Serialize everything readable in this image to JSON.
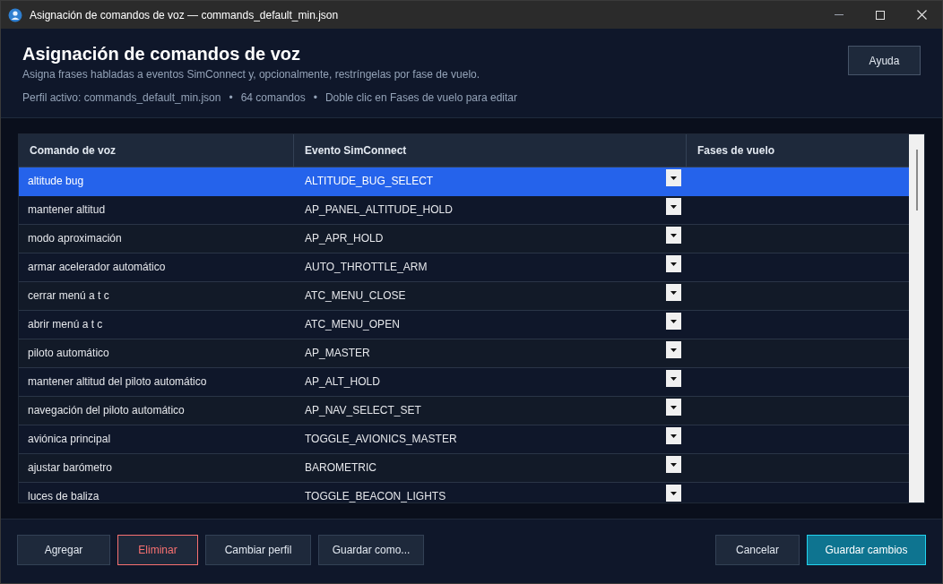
{
  "window": {
    "title": "Asignación de comandos de voz — commands_default_min.json"
  },
  "header": {
    "title": "Asignación de comandos de voz",
    "subtitle": "Asigna frases habladas a eventos SimConnect y, opcionalmente, restríngelas por fase de vuelo.",
    "meta": [
      "Perfil activo: commands_default_min.json",
      "64 comandos",
      "Doble clic en Fases de vuelo para editar"
    ],
    "separator": "•",
    "help_button": "Ayuda"
  },
  "table": {
    "columns": [
      "Comando de voz",
      "Evento SimConnect",
      "Fases de vuelo"
    ],
    "rows": [
      {
        "command": "altitude bug",
        "event": "ALTITUDE_BUG_SELECT",
        "selected": true
      },
      {
        "command": "mantener altitud",
        "event": "AP_PANEL_ALTITUDE_HOLD",
        "selected": false
      },
      {
        "command": "modo aproximación",
        "event": "AP_APR_HOLD",
        "selected": false
      },
      {
        "command": "armar acelerador automático",
        "event": "AUTO_THROTTLE_ARM",
        "selected": false
      },
      {
        "command": "cerrar menú a t c",
        "event": "ATC_MENU_CLOSE",
        "selected": false
      },
      {
        "command": "abrir menú a t c",
        "event": "ATC_MENU_OPEN",
        "selected": false
      },
      {
        "command": "piloto automático",
        "event": "AP_MASTER",
        "selected": false
      },
      {
        "command": "mantener altitud del piloto automático",
        "event": "AP_ALT_HOLD",
        "selected": false
      },
      {
        "command": "navegación del piloto automático",
        "event": "AP_NAV_SELECT_SET",
        "selected": false
      },
      {
        "command": "aviónica principal",
        "event": "TOGGLE_AVIONICS_MASTER",
        "selected": false
      },
      {
        "command": "ajustar barómetro",
        "event": "BAROMETRIC",
        "selected": false
      },
      {
        "command": "luces de baliza",
        "event": "TOGGLE_BEACON_LIGHTS",
        "selected": false
      }
    ]
  },
  "footer": {
    "left_buttons": [
      {
        "label": "Agregar",
        "kind": "normal"
      },
      {
        "label": "Eliminar",
        "kind": "danger"
      },
      {
        "label": "Cambiar perfil",
        "kind": "normal"
      },
      {
        "label": "Guardar como...",
        "kind": "normal"
      }
    ],
    "right_buttons": [
      {
        "label": "Cancelar",
        "kind": "normal"
      },
      {
        "label": "Guardar cambios",
        "kind": "primary"
      }
    ]
  }
}
